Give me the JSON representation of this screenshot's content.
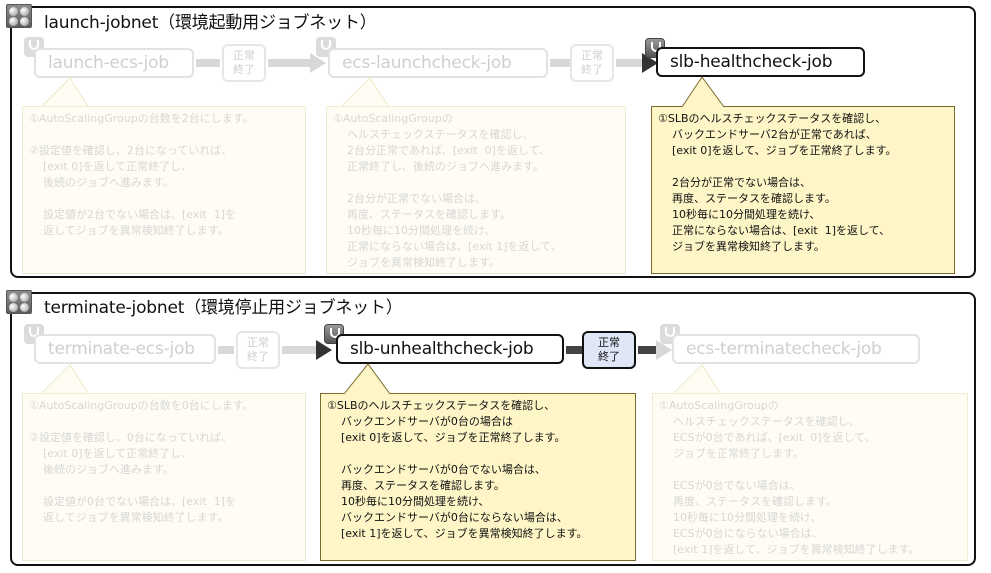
{
  "launch": {
    "title": "launch-jobnet（環境起動用ジョブネット）",
    "jobs": [
      {
        "label": "launch-ecs-job"
      },
      {
        "label": "ecs-launchcheck-job"
      },
      {
        "label": "slb-healthcheck-job"
      }
    ],
    "statuses": [
      "正常\n終了",
      "正常\n終了"
    ],
    "notes": [
      "①AutoScalingGroupの台数を2台にします。\n\n②設定値を確認し、2台になっていれば、\n    [exit 0]を返して正常終了し、\n    後続のジョブへ進みます。\n\n    設定値が2台でない場合は、[exit  1]を\n    返してジョブを異常検知終了します。",
      "①AutoScalingGroupの\n    ヘルスチェックステータスを確認し、\n    2台分正常であれば、[exit  0]を返して、\n    正常終了し、後続のジョブへ進みます。\n\n    2台分が正常でない場合は、\n    再度、ステータスを確認します。\n    10秒毎に10分間処理を続け、\n    正常にならない場合は、[exit 1]を返して、\n    ジョブを異常検知終了します。",
      "①SLBのヘルスチェックステータスを確認し、\n    バックエンドサーバ2台が正常であれば、\n    [exit 0]を返して、ジョブを正常終了します。\n\n    2台分が正常でない場合は、\n    再度、ステータスを確認します。\n    10秒毎に10分間処理を続け、\n    正常にならない場合は、[exit  1]を返して、\n    ジョブを異常検知終了します。"
    ]
  },
  "terminate": {
    "title": "terminate-jobnet（環境停止用ジョブネット）",
    "jobs": [
      {
        "label": "terminate-ecs-job"
      },
      {
        "label": "slb-unhealthcheck-job"
      },
      {
        "label": "ecs-terminatecheck-job"
      }
    ],
    "statuses": [
      "正常\n終了",
      "正常\n終了"
    ],
    "notes": [
      "①AutoScalingGroupの台数を0台にします。\n\n②設定値を確認し、0台になっていれば、\n    [exit 0]を返して正常終了し、\n    後続のジョブへ進みます。\n\n    設定値が0台でない場合は、[exit  1]を\n    返してジョブを異常検知終了します。",
      "①SLBのヘルスチェックステータスを確認し、\n    バックエンドサーバが0台の場合は\n    [exit 0]を返して、ジョブを正常終了します。\n\n    バックエンドサーバが0台でない場合は、\n    再度、ステータスを確認します。\n    10秒毎に10分間処理を続け、\n    バックエンドサーバが0台にならない場合は、\n    [exit 1]を返して、ジョブを異常検知終了します。",
      "①AutoScalingGroupの\n    ヘルスチェックステータスを確認し、\n    ECSが0台であれば、[exit  0]を返して、\n    ジョブを正常終了します。\n\n    ECSが0台でない場合は、\n    再度、ステータスを確認します。\n    10秒毎に10分間処理を続け、\n    ECSが0台にならない場合は、\n    [exit 1]を返して、ジョブを異常検知終了します。"
    ]
  }
}
